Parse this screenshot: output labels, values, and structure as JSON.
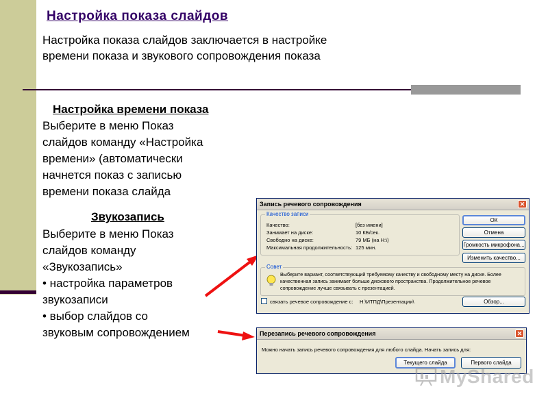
{
  "slide": {
    "title": "Настройка показа слайдов",
    "intro_lines": [
      "Настройка показа слайдов заключается в настройке",
      "времени показа и звукового сопровождения показа"
    ],
    "timing": {
      "heading": "Настройка времени показа",
      "lines": [
        "Выберите в меню Показ",
        "слайдов команду «Настройка",
        "времени» (автоматически",
        "начнется показ с записью",
        "времени показа слайда"
      ]
    },
    "sound": {
      "heading": "Звукозапись",
      "lines": [
        "Выберите в меню Показ",
        "слайдов команду",
        "«Звукозапись»",
        "• настройка параметров",
        "звукозаписи",
        "• выбор слайдов со",
        "звуковым сопровождением"
      ]
    },
    "colors": {
      "band": "#cccc99",
      "rule": "#330033",
      "accent_gray": "#999999",
      "arrow": "#ee1111",
      "title": "#330066"
    }
  },
  "dialog_record": {
    "title": "Запись речевого сопровождения",
    "close_icon": "close-icon",
    "quality_group": {
      "label": "Качество записи",
      "rows": [
        {
          "key": "Качество:",
          "value": "[без имени]"
        },
        {
          "key": "Занимает на диске:",
          "value": "10 КБ/сек."
        },
        {
          "key": "Свободно на диске:",
          "value": "79 МБ (на H:\\)"
        },
        {
          "key": "Максимальная продолжительность:",
          "value": "125 мин."
        }
      ]
    },
    "buttons": {
      "ok": "ОК",
      "cancel": "Отмена",
      "mic_volume": "Громкость микрофона...",
      "change_quality": "Изменить качество...",
      "browse": "Обзор..."
    },
    "tip_group": {
      "label": "Совет",
      "icon": "lightbulb-icon",
      "text_lines": [
        "Выберите вариант, соответствующий требуемому качеству и свободному месту на диске. Более",
        "качественная запись занимает больше дискового пространства. Продолжительное речевое",
        "сопровождение лучше связывать с презентацией."
      ]
    },
    "link_checkbox": {
      "label": "связать речевое сопровождение с:",
      "path": "H:\\ИТПД\\Презентации\\",
      "checked": false
    }
  },
  "dialog_rerecord": {
    "title": "Перезапись речевого сопровождения",
    "close_icon": "close-icon",
    "message": "Можно начать запись речевого сопровождения для любого слайда. Начать запись для:",
    "buttons": {
      "current_slide": "Текущего слайда",
      "first_slide": "Первого слайда"
    }
  },
  "watermark": {
    "text": "MyShared",
    "icon": "presentation-board-icon"
  }
}
